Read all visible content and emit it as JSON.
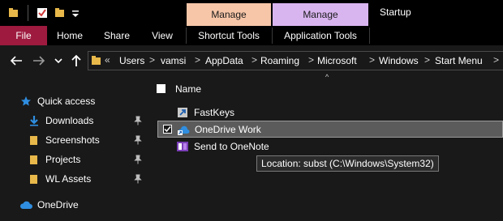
{
  "window": {
    "title": "Startup"
  },
  "colors": {
    "file_tab": "#9e1a3f",
    "manage_shortcut": "#f7c6a8",
    "manage_application": "#d9b5f0",
    "accent_blue": "#2f8ee0",
    "folder_yellow": "#e8b84a"
  },
  "ribbon": {
    "context_tabs": [
      {
        "label": "Manage",
        "group": "Shortcut Tools"
      },
      {
        "label": "Manage",
        "group": "Application Tools"
      }
    ],
    "tabs": [
      "File",
      "Home",
      "Share",
      "View"
    ]
  },
  "address": {
    "overflow": "«",
    "crumbs": [
      "Users",
      "vamsi",
      "AppData",
      "Roaming",
      "Microsoft",
      "Windows",
      "Start Menu"
    ],
    "separator": ">"
  },
  "nav": {
    "items": [
      {
        "label": "Quick access",
        "icon": "star-icon"
      },
      {
        "label": "Downloads",
        "icon": "download-arrow-icon",
        "pinned": true
      },
      {
        "label": "Screenshots",
        "icon": "folder-icon",
        "pinned": true
      },
      {
        "label": "Projects",
        "icon": "folder-icon",
        "pinned": true
      },
      {
        "label": "WL Assets",
        "icon": "folder-icon",
        "pinned": true
      },
      {
        "label": "OneDrive",
        "icon": "cloud-icon"
      }
    ]
  },
  "content": {
    "column_header": "Name",
    "rows": [
      {
        "name": "FastKeys",
        "icon": "shortcut-icon",
        "selected": false
      },
      {
        "name": "OneDrive Work",
        "icon": "shortcut-icon",
        "selected": true
      },
      {
        "name": "Send to OneNote",
        "icon": "onenote-icon",
        "selected": false
      }
    ],
    "tooltip": "Location: subst (C:\\Windows\\System32)"
  }
}
